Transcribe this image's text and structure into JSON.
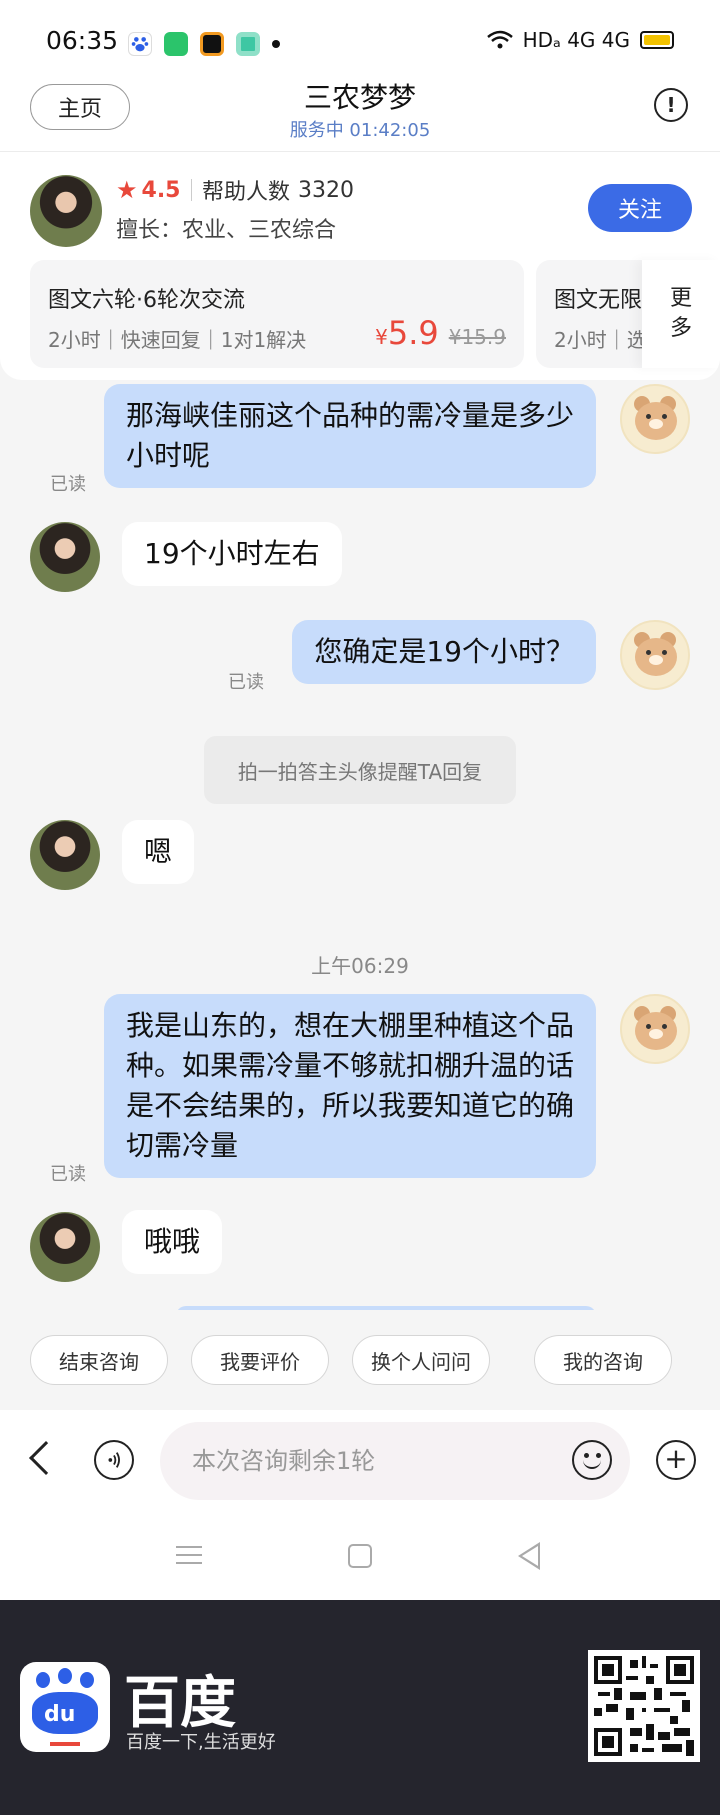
{
  "status_bar": {
    "time": "06:35",
    "network": "HDₐ 4G 4G"
  },
  "header": {
    "home_label": "主页",
    "title": "三农梦梦",
    "subtitle": "服务中 01:42:05",
    "info_icon": "!"
  },
  "expert": {
    "rating": "4.5",
    "helped_label": "帮助人数",
    "helped_count": "3320",
    "specialty": "擅长：农业、三农综合",
    "follow_label": "关注",
    "plans": [
      {
        "name": "图文六轮·6轮次交流",
        "tags": "2小时｜快速回复｜1对1解决",
        "price_symbol": "¥",
        "price": "5.9",
        "original_price": "¥15.9"
      },
      {
        "name": "图文无限",
        "tags": "2小时｜选"
      }
    ],
    "more_label": "更多"
  },
  "chat": {
    "messages": [
      {
        "from": "me",
        "text": "那海峡佳丽这个品种的需冷量是多少小时呢",
        "read": "已读"
      },
      {
        "from": "them",
        "text": "19个小时左右"
      },
      {
        "from": "me",
        "text": "您确定是19个小时？",
        "read": "已读"
      },
      {
        "from": "system",
        "text": "拍一拍答主头像提醒TA回复"
      },
      {
        "from": "them",
        "text": "嗯"
      },
      {
        "from": "time",
        "text": "上午06:29"
      },
      {
        "from": "me",
        "text": "我是山东的，想在大棚里种植这个品种。如果需冷量不够就扣棚升温的话是不会结果的，所以我要知道它的确切需冷量",
        "read": "已读"
      },
      {
        "from": "them",
        "text": "哦哦"
      }
    ]
  },
  "quick_actions": [
    "结束咨询",
    "我要评价",
    "换个人问问",
    "我的咨询"
  ],
  "input": {
    "placeholder": "本次咨询剩余1轮"
  },
  "footer": {
    "brand": "百度",
    "slogan": "百度一下,生活更好",
    "logo_text": "du"
  },
  "colors": {
    "accent": "#3b6be6",
    "price": "#e8483b",
    "my_bubble": "#c7dcfb",
    "subtitle": "#5a7ec6",
    "footer_bg": "#25252d"
  }
}
